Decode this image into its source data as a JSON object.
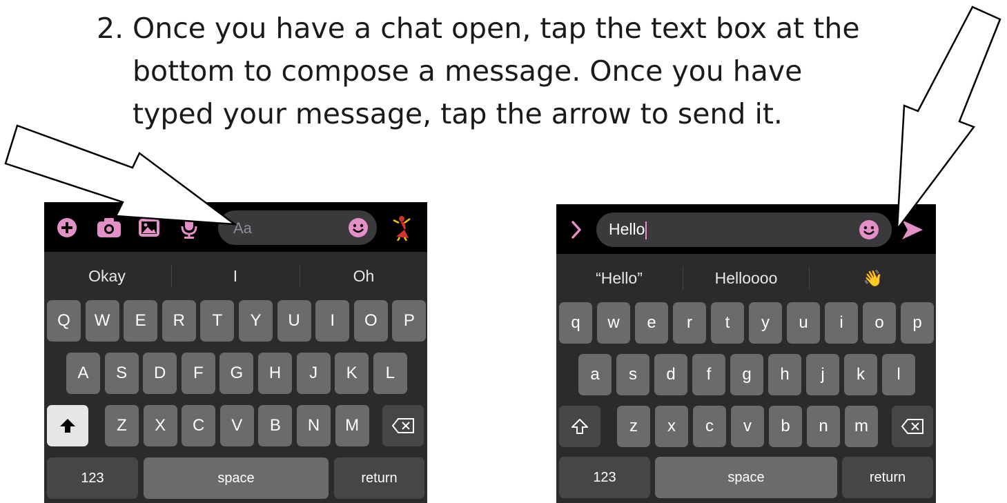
{
  "instruction": {
    "number": "2.",
    "lines": [
      "Once you have a chat open, tap the text box at the",
      "bottom to compose a message. Once you have",
      "typed your message, tap the arrow to send it."
    ]
  },
  "colors": {
    "accent": "#e58fc8",
    "topbar": "#000000",
    "keyboard": "#2b2b2b",
    "key": "#6b6b6b"
  },
  "left_panel": {
    "toolbar_icons": [
      "plus-icon",
      "camera-icon",
      "gallery-icon",
      "microphone-icon"
    ],
    "text_placeholder": "Aa",
    "emoji_icon": "smiley-icon",
    "extra_icon": "dancer-emoji-icon",
    "suggestions": [
      "Okay",
      "I",
      "Oh"
    ],
    "row1": [
      "Q",
      "W",
      "E",
      "R",
      "T",
      "Y",
      "U",
      "I",
      "O",
      "P"
    ],
    "row2": [
      "A",
      "S",
      "D",
      "F",
      "G",
      "H",
      "J",
      "K",
      "L"
    ],
    "row3": [
      "Z",
      "X",
      "C",
      "V",
      "B",
      "N",
      "M"
    ],
    "shift_icon": "shift-filled-icon",
    "delete_icon": "delete-icon",
    "numbers_label": "123",
    "space_label": "space",
    "return_label": "return"
  },
  "right_panel": {
    "expand_icon": "chevron-right-icon",
    "text_value": "Hello",
    "emoji_icon": "smiley-icon",
    "send_icon": "send-arrow-icon",
    "suggestions": [
      "“Hello”",
      "Helloooo",
      "👋"
    ],
    "row1": [
      "q",
      "w",
      "e",
      "r",
      "t",
      "y",
      "u",
      "i",
      "o",
      "p"
    ],
    "row2": [
      "a",
      "s",
      "d",
      "f",
      "g",
      "h",
      "j",
      "k",
      "l"
    ],
    "row3": [
      "z",
      "x",
      "c",
      "v",
      "b",
      "n",
      "m"
    ],
    "shift_icon": "shift-outline-icon",
    "delete_icon": "delete-icon",
    "numbers_label": "123",
    "space_label": "space",
    "return_label": "return"
  }
}
